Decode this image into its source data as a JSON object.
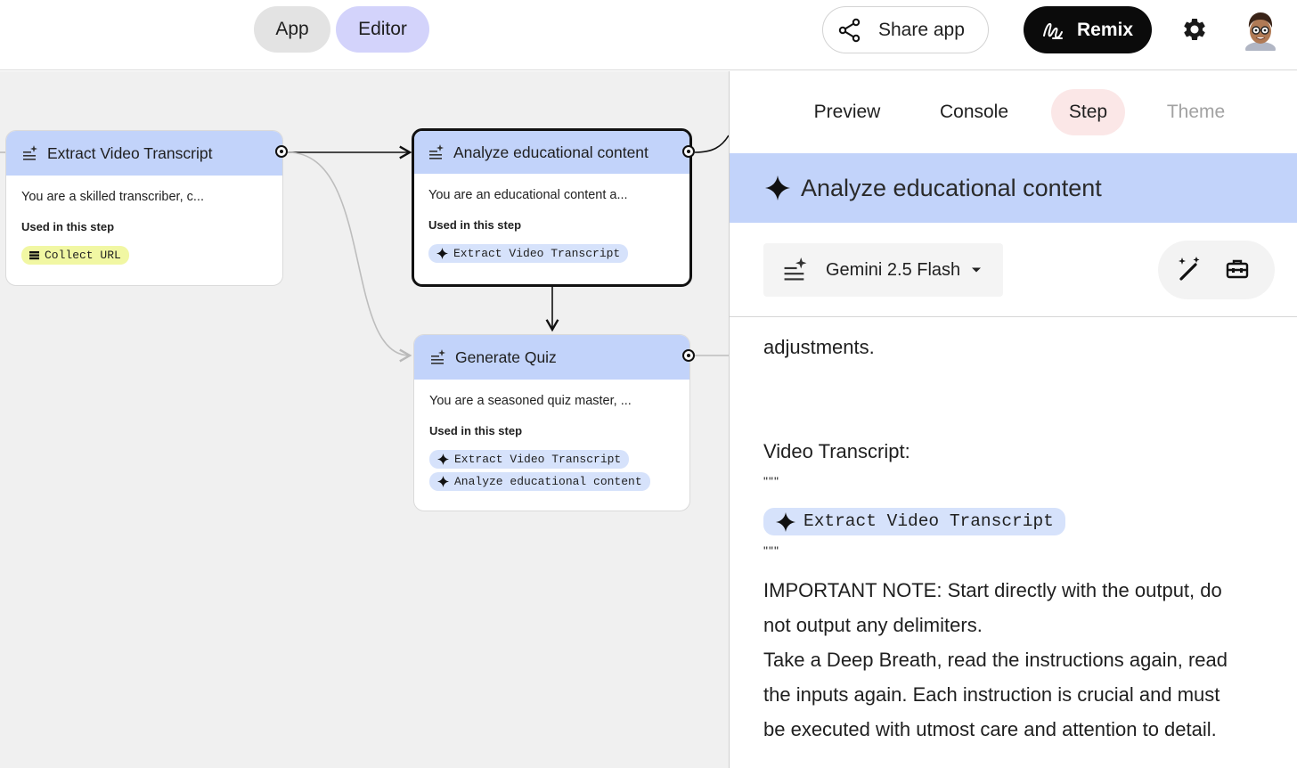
{
  "topbar": {
    "tabs": {
      "app": "App",
      "editor": "Editor"
    },
    "share_label": "Share app",
    "remix_label": "Remix"
  },
  "canvas": {
    "nodes": [
      {
        "title": "Extract Video Transcript",
        "description": "You are a skilled transcriber, c...",
        "used_label": "Used in this step",
        "inputs": [
          "Collect URL"
        ]
      },
      {
        "title": "Analyze educational content",
        "description": "You are an educational content a...",
        "used_label": "Used in this step",
        "inputs": [
          "Extract Video Transcript"
        ],
        "selected": true
      },
      {
        "title": "Generate Quiz",
        "description": "You are a seasoned quiz master, ...",
        "used_label": "Used in this step",
        "inputs": [
          "Extract Video Transcript",
          "Analyze educational content"
        ]
      }
    ]
  },
  "panel": {
    "tabs": [
      "Preview",
      "Console",
      "Step",
      "Theme"
    ],
    "active_tab": "Step",
    "step_title": "Analyze educational content",
    "model": "Gemini 2.5 Flash",
    "prompt": {
      "line1": "adjustments.",
      "transcript_label": "Video Transcript:",
      "quote_open": "\"\"\"",
      "chip": "Extract Video Transcript",
      "quote_close": "\"\"\"",
      "note_lines": [
        "IMPORTANT NOTE: Start directly with the output, do",
        "not output any delimiters.",
        "Take a Deep Breath, read the instructions again, read",
        "the inputs again. Each instruction is crucial and must",
        "be executed with utmost care and attention to detail."
      ]
    }
  },
  "colors": {
    "node_header": "#c2d3fa",
    "chip_blue": "#d6e2fb",
    "chip_yellow": "#f1f7a3",
    "active_tab": "#fbe7e7",
    "editor_pill": "#d3d3fb"
  },
  "icons": [
    "share-icon",
    "remix-icon",
    "gear-icon",
    "avatar",
    "generate-text-icon",
    "spark-icon",
    "list-icon",
    "dropdown-caret-icon",
    "magic-wand-icon",
    "toolbox-icon"
  ]
}
